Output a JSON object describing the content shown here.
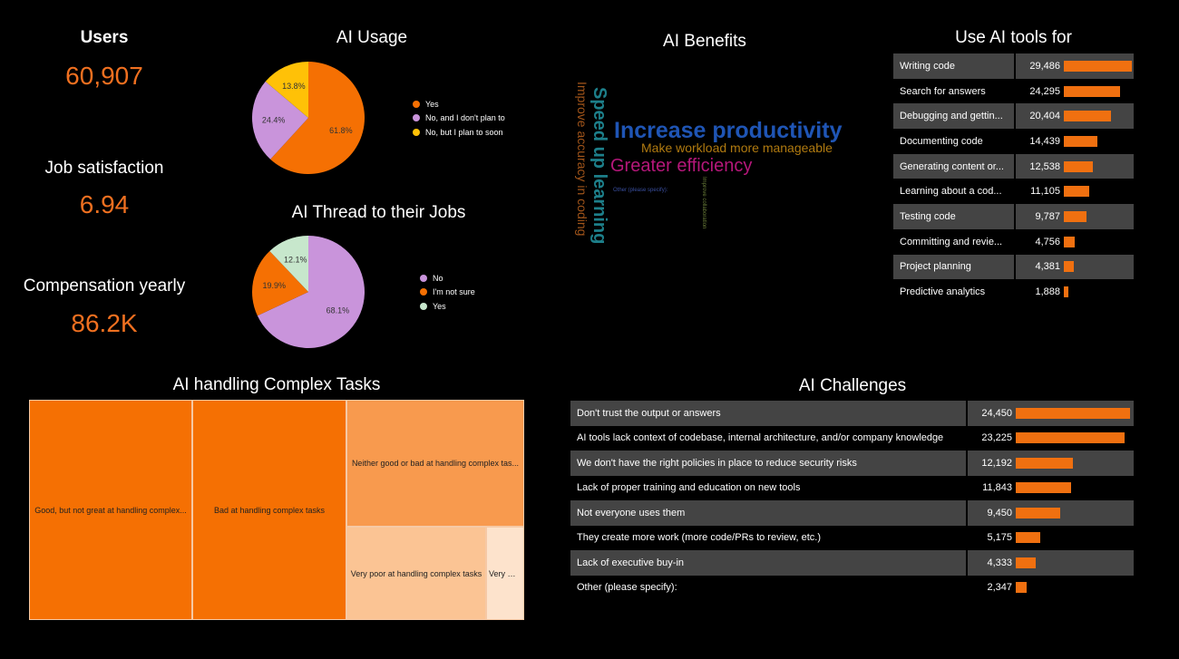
{
  "kpis": {
    "users": {
      "label": "Users",
      "value": "60,907"
    },
    "job_satisfaction": {
      "label": "Job satisfaction",
      "value": "6.94"
    },
    "compensation": {
      "label": "Compensation yearly",
      "value": "86.2K"
    }
  },
  "chart_data": [
    {
      "type": "pie",
      "id": "ai-usage",
      "title": "AI Usage",
      "slices": [
        {
          "label": "Yes",
          "value": 61.8,
          "color": "#F57003"
        },
        {
          "label": "No, and I don't plan to",
          "value": 24.4,
          "color": "#C994DB"
        },
        {
          "label": "No, but I plan to soon",
          "value": 13.8,
          "color": "#FFC107"
        }
      ],
      "value_labels": [
        "61.8%",
        "24.4%",
        "13.8%"
      ]
    },
    {
      "type": "pie",
      "id": "ai-threat",
      "title": "AI Thread to their Jobs",
      "slices": [
        {
          "label": "No",
          "value": 68.1,
          "color": "#C994DB"
        },
        {
          "label": "I'm not sure",
          "value": 19.9,
          "color": "#F57003"
        },
        {
          "label": "Yes",
          "value": 12.1,
          "color": "#C7E7CC"
        }
      ],
      "value_labels": [
        "68.1%",
        "19.9%",
        "12.1%"
      ]
    },
    {
      "type": "wordcloud",
      "id": "ai-benefits",
      "title": "AI Benefits",
      "words": [
        {
          "text": "Increase productivity",
          "color": "#1F55B5"
        },
        {
          "text": "Speed up learning",
          "color": "#1D7F8A"
        },
        {
          "text": "Greater efficiency",
          "color": "#B5177A"
        },
        {
          "text": "Make workload more manageable",
          "color": "#B07A10"
        },
        {
          "text": "Improve accuracy in coding",
          "color": "#A0541A"
        },
        {
          "text": "Improve collaboration",
          "color": "#6B7F3A"
        },
        {
          "text": "Other (please specify):",
          "color": "#3A4FA0"
        }
      ]
    },
    {
      "type": "table",
      "id": "use-ai-tools",
      "title": "Use AI tools for",
      "max": 29486,
      "rows": [
        {
          "label": "Writing code",
          "value": 29486,
          "display": "29,486"
        },
        {
          "label": "Search for answers",
          "value": 24295,
          "display": "24,295"
        },
        {
          "label": "Debugging and gettin...",
          "value": 20404,
          "display": "20,404"
        },
        {
          "label": "Documenting code",
          "value": 14439,
          "display": "14,439"
        },
        {
          "label": "Generating content or...",
          "value": 12538,
          "display": "12,538"
        },
        {
          "label": "Learning about a cod...",
          "value": 11105,
          "display": "11,105"
        },
        {
          "label": "Testing code",
          "value": 9787,
          "display": "9,787"
        },
        {
          "label": "Committing and revie...",
          "value": 4756,
          "display": "4,756"
        },
        {
          "label": "Project planning",
          "value": 4381,
          "display": "4,381"
        },
        {
          "label": "Predictive analytics",
          "value": 1888,
          "display": "1,888"
        }
      ]
    },
    {
      "type": "treemap",
      "id": "ai-complex-tasks",
      "title": "AI handling Complex Tasks",
      "cells": [
        {
          "label": "Good, but not great at handling complex...",
          "color": "#F57003"
        },
        {
          "label": "Bad at handling complex tasks",
          "color": "#F57003"
        },
        {
          "label": "Neither good or bad at handling complex tas...",
          "color": "#F89A4E"
        },
        {
          "label": "Very poor at handling complex tasks",
          "color": "#FBC494"
        },
        {
          "label": "Very wel...",
          "color": "#FDE3CC"
        }
      ]
    },
    {
      "type": "table",
      "id": "ai-challenges",
      "title": "AI Challenges",
      "max": 24450,
      "rows": [
        {
          "label": "Don't trust the output or answers",
          "value": 24450,
          "display": "24,450"
        },
        {
          "label": "AI tools lack context of codebase, internal architecture, and/or company knowledge",
          "value": 23225,
          "display": "23,225"
        },
        {
          "label": "We don't have the right policies in place to reduce security risks",
          "value": 12192,
          "display": "12,192"
        },
        {
          "label": "Lack of proper training and education on new tools",
          "value": 11843,
          "display": "11,843"
        },
        {
          "label": "Not everyone uses them",
          "value": 9450,
          "display": "9,450"
        },
        {
          "label": "They create more work (more code/PRs to review, etc.)",
          "value": 5175,
          "display": "5,175"
        },
        {
          "label": "Lack of executive buy-in",
          "value": 4333,
          "display": "4,333"
        },
        {
          "label": "Other (please specify):",
          "value": 2347,
          "display": "2,347"
        }
      ]
    }
  ]
}
